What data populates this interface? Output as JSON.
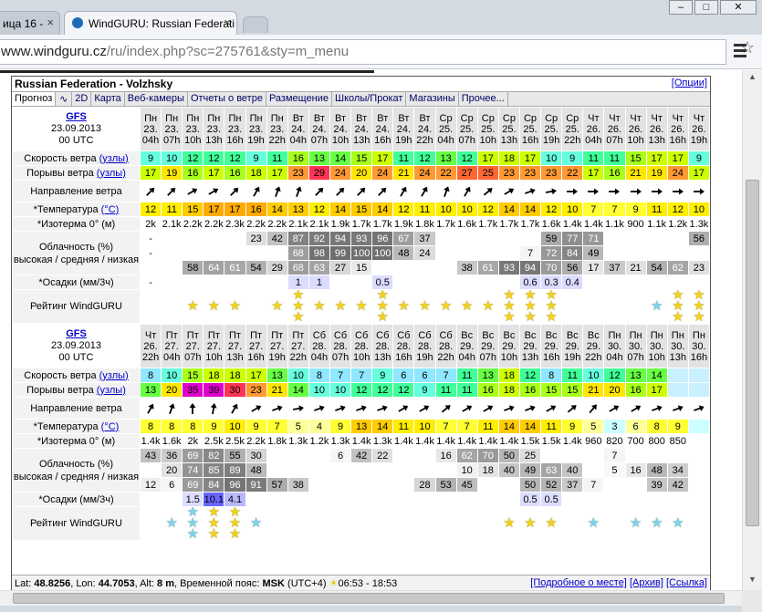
{
  "browser": {
    "tabs": [
      {
        "label": "ица 16 -"
      },
      {
        "label": "WindGURU: Russian Federati"
      }
    ],
    "url_host": "www.windguru.cz",
    "url_path": "/ru/index.php?sc=275761&sty=m_menu"
  },
  "page": {
    "location": "Russian Federation - Volzhsky",
    "options": "[Опции]",
    "menu": [
      "Прогноз",
      "2D",
      "Карта",
      "Веб-камеры",
      "Отчеты о ветре",
      "Размещение",
      "Школы/Прокат",
      "Магазины",
      "Прочее..."
    ],
    "labels": {
      "wind": "Скорость ветра",
      "wind_unit": "(узлы)",
      "gust": "Порывы ветра",
      "gust_unit": "(узлы)",
      "dir": "Направление ветра",
      "temp": "*Температура",
      "temp_unit": "(°C)",
      "iso": "*Изотерма 0° (м)",
      "cloud1": "Облачность (%)",
      "cloud2": "высокая / средняя / низкая",
      "precip": "*Осадки (мм/3ч)",
      "rating": "Рейтинг WindGURU"
    },
    "footer": {
      "lat_label": "Lat:",
      "lat": "48.8256",
      "lon_label": "Lon:",
      "lon": "44.7053",
      "alt_label": "Alt:",
      "alt": "8 m",
      "tz_label": "Временной пояс:",
      "tz": "MSK",
      "tz_offset": "(UTC+4)",
      "sun": "06:53 - 18:53",
      "links": [
        "[Подробное о месте]",
        "[Архив]",
        "[Ссылка]"
      ]
    }
  },
  "blocks": [
    {
      "model": "GFS",
      "date": "23.09.2013",
      "run": "00 UTC",
      "cols": [
        [
          "Пн",
          "23.",
          "04h"
        ],
        [
          "Пн",
          "23.",
          "07h"
        ],
        [
          "Пн",
          "23.",
          "10h"
        ],
        [
          "Пн",
          "23.",
          "13h"
        ],
        [
          "Пн",
          "23.",
          "16h"
        ],
        [
          "Пн",
          "23.",
          "19h"
        ],
        [
          "Пн",
          "23.",
          "22h"
        ],
        [
          "Вт",
          "24.",
          "04h"
        ],
        [
          "Вт",
          "24.",
          "07h"
        ],
        [
          "Вт",
          "24.",
          "10h"
        ],
        [
          "Вт",
          "24.",
          "13h"
        ],
        [
          "Вт",
          "24.",
          "16h"
        ],
        [
          "Вт",
          "24.",
          "19h"
        ],
        [
          "Вт",
          "24.",
          "22h"
        ],
        [
          "Ср",
          "25.",
          "04h"
        ],
        [
          "Ср",
          "25.",
          "07h"
        ],
        [
          "Ср",
          "25.",
          "10h"
        ],
        [
          "Ср",
          "25.",
          "13h"
        ],
        [
          "Ср",
          "25.",
          "16h"
        ],
        [
          "Ср",
          "25.",
          "19h"
        ],
        [
          "Ср",
          "25.",
          "22h"
        ],
        [
          "Чт",
          "26.",
          "04h"
        ],
        [
          "Чт",
          "26.",
          "07h"
        ],
        [
          "Чт",
          "26.",
          "10h"
        ],
        [
          "Чт",
          "26.",
          "13h"
        ],
        [
          "Чт",
          "26.",
          "16h"
        ],
        [
          "Чт",
          "26.",
          "19h"
        ]
      ],
      "wind": [
        "9",
        "10",
        "12",
        "12",
        "12",
        "9",
        "11",
        "16",
        "13",
        "14",
        "15",
        "17",
        "11",
        "12",
        "13",
        "12",
        "17",
        "18",
        "17",
        "10",
        "9",
        "11",
        "11",
        "15",
        "17",
        "17",
        "9"
      ],
      "gust": [
        "17",
        "19",
        "16",
        "17",
        "16",
        "18",
        "17",
        "23",
        "29",
        "24",
        "20",
        "24",
        "21",
        "24",
        "22",
        "27",
        "25",
        "23",
        "23",
        "23",
        "22",
        "17",
        "16",
        "21",
        "19",
        "24",
        "17"
      ],
      "dir": [
        225,
        225,
        240,
        240,
        225,
        210,
        200,
        200,
        225,
        225,
        225,
        225,
        210,
        210,
        200,
        210,
        230,
        240,
        250,
        260,
        270,
        270,
        270,
        270,
        270,
        270,
        270
      ],
      "temp": [
        "12",
        "11",
        "15",
        "17",
        "17",
        "16",
        "14",
        "13",
        "12",
        "14",
        "15",
        "14",
        "12",
        "11",
        "10",
        "10",
        "12",
        "14",
        "14",
        "12",
        "10",
        "7",
        "7",
        "9",
        "11",
        "12",
        "10"
      ],
      "iso": [
        "2k",
        "2.1k",
        "2.2k",
        "2.2k",
        "2.3k",
        "2.2k",
        "2.2k",
        "2.1k",
        "2.1k",
        "1.9k",
        "1.7k",
        "1.7k",
        "1.9k",
        "1.8k",
        "1.7k",
        "1.6k",
        "1.7k",
        "1.7k",
        "1.7k",
        "1.6k",
        "1.4k",
        "1.4k",
        "1.1k",
        "900",
        "1.1k",
        "1.2k",
        "1.3k"
      ],
      "ch": [
        "-",
        "",
        "",
        "",
        "",
        "23",
        "42",
        "87",
        "92",
        "94",
        "93",
        "96",
        "67",
        "37",
        "",
        "",
        "",
        "",
        "",
        "59",
        "77",
        "71",
        "",
        "",
        "",
        "",
        "56"
      ],
      "cm": [
        "-",
        "",
        "",
        "",
        "",
        "",
        "",
        "68",
        "98",
        "99",
        "100",
        "100",
        "48",
        "24",
        "",
        "",
        "",
        "",
        "7",
        "72",
        "84",
        "49",
        "",
        "",
        "",
        "",
        ""
      ],
      "cl": [
        "",
        "",
        "58",
        "64",
        "61",
        "54",
        "29",
        "68",
        "63",
        "27",
        "15",
        "",
        "",
        "",
        "",
        "38",
        "61",
        "93",
        "94",
        "70",
        "56",
        "17",
        "37",
        "21",
        "54",
        "62",
        "23"
      ],
      "prec": [
        "-",
        "",
        "",
        "",
        "",
        "",
        "",
        "1",
        "1",
        "",
        "",
        "0.5",
        "",
        "",
        "",
        "",
        "",
        "",
        "0.6",
        "0.3",
        "0.4",
        "",
        "",
        "",
        "",
        "",
        ""
      ],
      "rate": [
        "",
        "",
        "y1",
        "y1",
        "y1",
        "",
        "y1",
        "y3",
        "y1",
        "y1",
        "y1",
        "y3",
        "y1",
        "y1",
        "y1",
        "y1",
        "y1",
        "y3",
        "y3",
        "y3",
        "",
        "",
        "",
        "",
        "b1",
        "y3",
        "y3"
      ]
    },
    {
      "model": "GFS",
      "date": "23.09.2013",
      "run": "00 UTC",
      "cols": [
        [
          "Чт",
          "26.",
          "22h"
        ],
        [
          "Пт",
          "27.",
          "04h"
        ],
        [
          "Пт",
          "27.",
          "07h"
        ],
        [
          "Пт",
          "27.",
          "10h"
        ],
        [
          "Пт",
          "27.",
          "13h"
        ],
        [
          "Пт",
          "27.",
          "16h"
        ],
        [
          "Пт",
          "27.",
          "19h"
        ],
        [
          "Пт",
          "27.",
          "22h"
        ],
        [
          "Сб",
          "28.",
          "04h"
        ],
        [
          "Сб",
          "28.",
          "07h"
        ],
        [
          "Сб",
          "28.",
          "10h"
        ],
        [
          "Сб",
          "28.",
          "13h"
        ],
        [
          "Сб",
          "28.",
          "16h"
        ],
        [
          "Сб",
          "28.",
          "19h"
        ],
        [
          "Сб",
          "28.",
          "22h"
        ],
        [
          "Вс",
          "29.",
          "04h"
        ],
        [
          "Вс",
          "29.",
          "07h"
        ],
        [
          "Вс",
          "29.",
          "10h"
        ],
        [
          "Вс",
          "29.",
          "13h"
        ],
        [
          "Вс",
          "29.",
          "16h"
        ],
        [
          "Вс",
          "29.",
          "19h"
        ],
        [
          "Вс",
          "29.",
          "22h"
        ],
        [
          "Пн",
          "30.",
          "04h"
        ],
        [
          "Пн",
          "30.",
          "07h"
        ],
        [
          "Пн",
          "30.",
          "10h"
        ],
        [
          "Пн",
          "30.",
          "13h"
        ],
        [
          "Пн",
          "30.",
          "16h"
        ]
      ],
      "wind": [
        "8",
        "10",
        "15",
        "18",
        "18",
        "17",
        "13",
        "10",
        "8",
        "7",
        "7",
        "9",
        "6",
        "6",
        "7",
        "11",
        "13",
        "18",
        "12",
        "8",
        "11",
        "10",
        "12",
        "13",
        "14",
        "",
        ""
      ],
      "gust": [
        "13",
        "20",
        "35",
        "39",
        "30",
        "23",
        "21",
        "14",
        "10",
        "10",
        "12",
        "12",
        "12",
        "9",
        "11",
        "11",
        "16",
        "18",
        "16",
        "15",
        "15",
        "21",
        "20",
        "16",
        "17",
        "",
        ""
      ],
      "dir": [
        210,
        200,
        180,
        190,
        210,
        240,
        250,
        260,
        250,
        250,
        250,
        250,
        240,
        240,
        230,
        240,
        240,
        250,
        250,
        240,
        230,
        220,
        240,
        240,
        250,
        250,
        250
      ],
      "temp": [
        "8",
        "8",
        "8",
        "9",
        "10",
        "9",
        "7",
        "5",
        "4",
        "9",
        "13",
        "14",
        "11",
        "10",
        "7",
        "7",
        "11",
        "14",
        "14",
        "11",
        "9",
        "5",
        "3",
        "6",
        "8",
        "9",
        ""
      ],
      "iso": [
        "1.4k",
        "1.6k",
        "2k",
        "2.5k",
        "2.5k",
        "2.2k",
        "1.8k",
        "1.3k",
        "1.2k",
        "1.3k",
        "1.4k",
        "1.3k",
        "1.4k",
        "1.4k",
        "1.4k",
        "1.4k",
        "1.4k",
        "1.4k",
        "1.5k",
        "1.5k",
        "1.4k",
        "960",
        "820",
        "700",
        "800",
        "850",
        ""
      ],
      "ch": [
        "43",
        "36",
        "69",
        "82",
        "55",
        "30",
        "",
        "",
        "",
        "6",
        "42",
        "22",
        "",
        "",
        "16",
        "62",
        "70",
        "50",
        "25",
        "",
        "",
        "",
        "7",
        "",
        "",
        "",
        ""
      ],
      "cm": [
        "",
        "20",
        "74",
        "85",
        "89",
        "48",
        "",
        "",
        "",
        "",
        "",
        "",
        "",
        "",
        "",
        "10",
        "18",
        "40",
        "49",
        "63",
        "40",
        "",
        "5",
        "16",
        "48",
        "34",
        ""
      ],
      "cl": [
        "12",
        "6",
        "69",
        "84",
        "96",
        "91",
        "57",
        "38",
        "",
        "",
        "",
        "",
        "",
        "28",
        "53",
        "45",
        "",
        "",
        "50",
        "52",
        "37",
        "7",
        "",
        "",
        "39",
        "42",
        ""
      ],
      "prec": [
        "",
        "",
        "1.5",
        "10.1",
        "4.1",
        "",
        "",
        "",
        "",
        "",
        "",
        "",
        "",
        "",
        "",
        "",
        "",
        "",
        "0.5",
        "0.5",
        "",
        "",
        "",
        "",
        "",
        "",
        ""
      ],
      "rate": [
        "",
        "b1",
        "b3",
        "y3",
        "y3",
        "b1",
        "",
        "",
        "",
        "",
        "",
        "",
        "",
        "",
        "",
        "",
        "",
        "y1",
        "y1",
        "y1",
        "",
        "b1",
        "",
        "b1",
        "b1",
        "b1",
        ""
      ]
    }
  ]
}
